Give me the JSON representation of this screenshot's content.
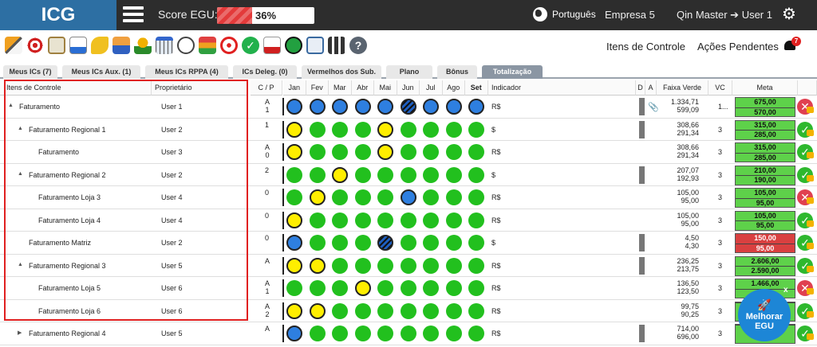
{
  "header": {
    "logo": "ICG",
    "score_label": "Score EGU:",
    "score_value": "36%",
    "score_fraction": 0.36,
    "language": "Português",
    "company": "Empresa 5",
    "user": "Qin Master ➔ User 1"
  },
  "toolbar": {
    "icons": [
      "edit-icon",
      "target-icon",
      "clipboard-icon",
      "download-chart-icon",
      "attach-icon",
      "team-icon",
      "award-icon",
      "calendar-icon",
      "stopwatch-icon",
      "hierarchy-icon",
      "crosshair-icon",
      "check-circle-icon",
      "report-pdf-icon",
      "power-pdf-icon",
      "presentation-icon",
      "apps-grid-icon",
      "help-icon"
    ],
    "itens_controle": "Itens de Controle",
    "acoes_pendentes": "Ações Pendentes",
    "bell_count": "7"
  },
  "tabs": [
    {
      "label": "Meus ICs (7)"
    },
    {
      "label": "Meus ICs Aux. (1)"
    },
    {
      "label": "Meus ICs RPPA (4)"
    },
    {
      "label": "ICs Deleg. (0)"
    },
    {
      "label": "Vermelhos dos Sub."
    },
    {
      "label": "Plano"
    },
    {
      "label": "Bônus"
    },
    {
      "label": "Totalização"
    }
  ],
  "columns": {
    "item": "Itens de Controle",
    "owner": "Proprietário",
    "cp": "C / P",
    "months": [
      "Jan",
      "Fev",
      "Mar",
      "Abr",
      "Mai",
      "Jun",
      "Jul",
      "Ago",
      "Set"
    ],
    "indicador": "Indicador",
    "d": "D",
    "a": "A",
    "faixa": "Faixa Verde",
    "vc": "VC",
    "meta": "Meta"
  },
  "rows": [
    {
      "item": "Faturamento",
      "indent": 0,
      "toggle": "▲",
      "owner": "User 1",
      "cp1": "A",
      "cp2": "1",
      "dots": [
        "b",
        "b",
        "b",
        "b",
        "b",
        "h",
        "b",
        "b",
        "b"
      ],
      "ind": "R$",
      "gray": true,
      "clip": true,
      "faixa1": "1.334,71",
      "faixa2": "599,09",
      "vc": "1...",
      "meta1": "675,00",
      "meta2": "570,00",
      "metaColor": "green",
      "status": "bad"
    },
    {
      "item": "Faturamento Regional 1",
      "indent": 1,
      "toggle": "▲",
      "owner": "User 2",
      "cp1": "1",
      "cp2": "",
      "dots": [
        "y",
        "g",
        "g",
        "g",
        "y",
        "g",
        "g",
        "g",
        "g"
      ],
      "ind": "$",
      "gray": true,
      "clip": false,
      "faixa1": "308,66",
      "faixa2": "291,34",
      "vc": "3",
      "meta1": "315,00",
      "meta2": "285,00",
      "metaColor": "green",
      "status": "ok"
    },
    {
      "item": "Faturamento",
      "indent": 2,
      "toggle": "",
      "owner": "User 3",
      "cp1": "A",
      "cp2": "0",
      "dots": [
        "y",
        "g",
        "g",
        "g",
        "y",
        "g",
        "g",
        "g",
        "g"
      ],
      "ind": "R$",
      "gray": false,
      "clip": false,
      "faixa1": "308,66",
      "faixa2": "291,34",
      "vc": "3",
      "meta1": "315,00",
      "meta2": "285,00",
      "metaColor": "green",
      "status": "ok"
    },
    {
      "item": "Faturamento Regional 2",
      "indent": 1,
      "toggle": "▲",
      "owner": "User 2",
      "cp1": "2",
      "cp2": "",
      "dots": [
        "g",
        "g",
        "y",
        "g",
        "g",
        "g",
        "g",
        "g",
        "g"
      ],
      "ind": "$",
      "gray": true,
      "clip": false,
      "faixa1": "207,07",
      "faixa2": "192,93",
      "vc": "3",
      "meta1": "210,00",
      "meta2": "190,00",
      "metaColor": "green",
      "status": "ok"
    },
    {
      "item": "Faturamento Loja 3",
      "indent": 2,
      "toggle": "",
      "owner": "User 4",
      "cp1": "0",
      "cp2": "",
      "dots": [
        "g",
        "y",
        "g",
        "g",
        "g",
        "b",
        "g",
        "g",
        "g"
      ],
      "ind": "R$",
      "gray": false,
      "clip": false,
      "faixa1": "105,00",
      "faixa2": "95,00",
      "vc": "3",
      "meta1": "105,00",
      "meta2": "95,00",
      "metaColor": "green",
      "status": "bad"
    },
    {
      "item": "Faturamento Loja 4",
      "indent": 2,
      "toggle": "",
      "owner": "User 4",
      "cp1": "0",
      "cp2": "",
      "dots": [
        "y",
        "g",
        "g",
        "g",
        "g",
        "g",
        "g",
        "g",
        "g"
      ],
      "ind": "R$",
      "gray": false,
      "clip": false,
      "faixa1": "105,00",
      "faixa2": "95,00",
      "vc": "3",
      "meta1": "105,00",
      "meta2": "95,00",
      "metaColor": "green",
      "status": "ok"
    },
    {
      "item": "Faturamento Matriz",
      "indent": 1,
      "toggle": "",
      "owner": "User 2",
      "cp1": "0",
      "cp2": "",
      "dots": [
        "b",
        "g",
        "g",
        "g",
        "h",
        "g",
        "g",
        "g",
        "g"
      ],
      "ind": "$",
      "gray": true,
      "clip": false,
      "faixa1": "4,50",
      "faixa2": "4,30",
      "vc": "3",
      "meta1": "150,00",
      "meta2": "95,00",
      "metaColor": "red",
      "status": "ok"
    },
    {
      "item": "Faturamento Regional 3",
      "indent": 1,
      "toggle": "▲",
      "owner": "User 5",
      "cp1": "A",
      "cp2": "",
      "dots": [
        "y",
        "y",
        "g",
        "g",
        "g",
        "g",
        "g",
        "g",
        "g"
      ],
      "ind": "R$",
      "gray": true,
      "clip": false,
      "faixa1": "236,25",
      "faixa2": "213,75",
      "vc": "3",
      "meta1": "2.606,00",
      "meta2": "2.590,00",
      "metaColor": "green",
      "status": "ok"
    },
    {
      "item": "Faturamento Loja 5",
      "indent": 2,
      "toggle": "",
      "owner": "User 6",
      "cp1": "A",
      "cp2": "1",
      "dots": [
        "g",
        "g",
        "g",
        "y",
        "g",
        "g",
        "g",
        "g",
        "g"
      ],
      "ind": "R$",
      "gray": false,
      "clip": false,
      "faixa1": "136,50",
      "faixa2": "123,50",
      "vc": "3",
      "meta1": "1.466,00",
      "meta2": "",
      "metaColor": "green",
      "status": "bad"
    },
    {
      "item": "Faturamento Loja 6",
      "indent": 2,
      "toggle": "",
      "owner": "User 6",
      "cp1": "A",
      "cp2": "2",
      "dots": [
        "y",
        "y",
        "g",
        "g",
        "g",
        "g",
        "g",
        "g",
        "g"
      ],
      "ind": "R$",
      "gray": false,
      "clip": false,
      "faixa1": "99,75",
      "faixa2": "90,25",
      "vc": "3",
      "meta1": "",
      "meta2": "",
      "metaColor": "green",
      "status": "ok"
    },
    {
      "item": "Faturamento Regional 4",
      "indent": 1,
      "toggle": "▶",
      "owner": "User 5",
      "cp1": "A",
      "cp2": "",
      "dots": [
        "b",
        "g",
        "g",
        "g",
        "g",
        "g",
        "g",
        "g",
        "g"
      ],
      "ind": "R$",
      "gray": true,
      "clip": false,
      "faixa1": "714,00",
      "faixa2": "696,00",
      "vc": "3",
      "meta1": "",
      "meta2": "",
      "metaColor": "green",
      "status": "ok"
    }
  ],
  "melhorar": {
    "line1": "Melhorar",
    "line2": "EGU",
    "close": "x"
  }
}
